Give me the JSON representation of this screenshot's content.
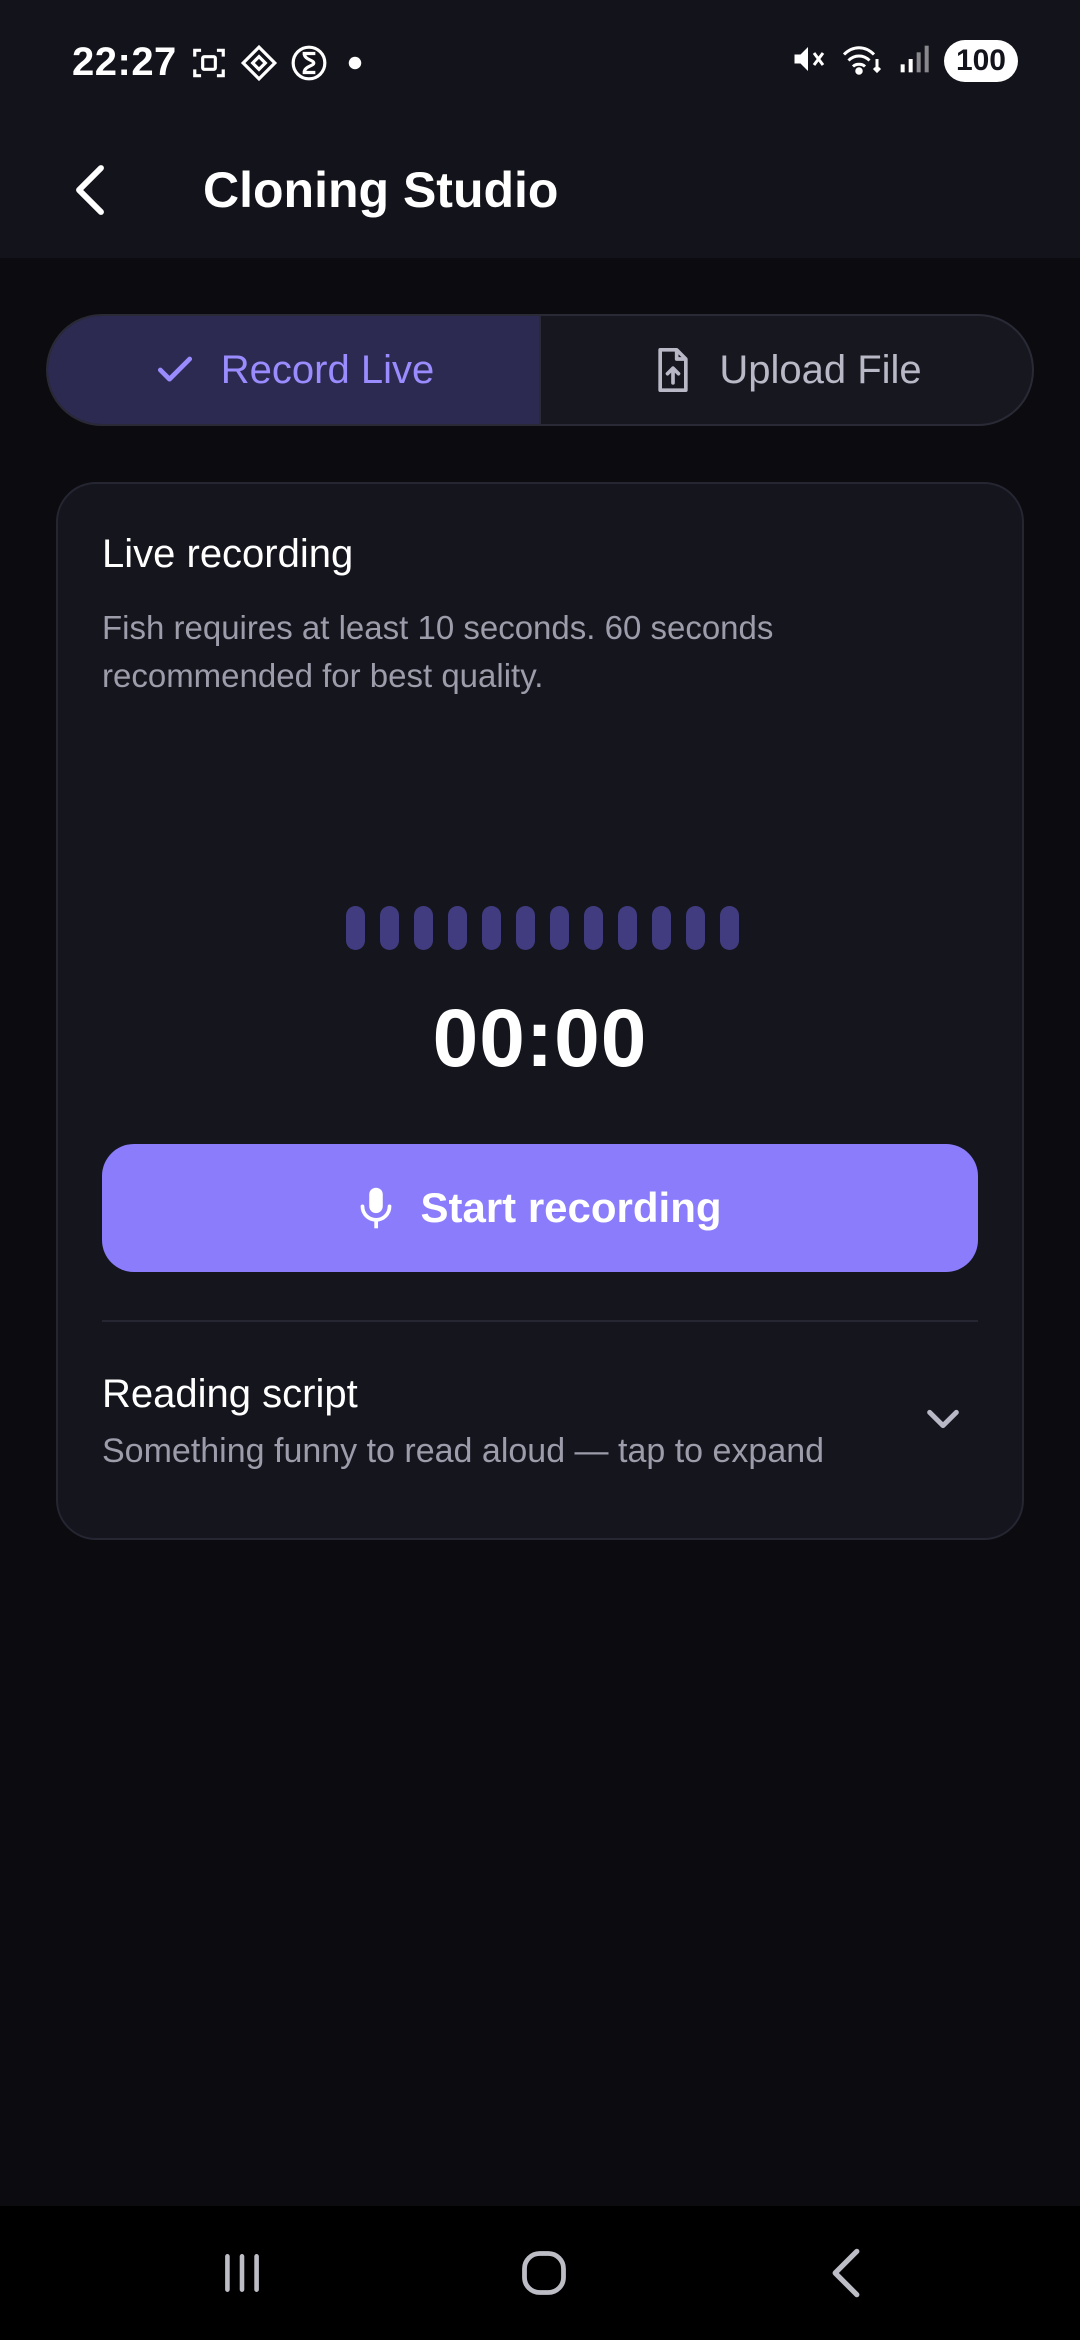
{
  "status_bar": {
    "time": "22:27",
    "battery": "100"
  },
  "header": {
    "title": "Cloning Studio"
  },
  "tabs": [
    {
      "label": "Record Live",
      "active": true,
      "icon": "check-icon"
    },
    {
      "label": "Upload File",
      "active": false,
      "icon": "file-upload-icon"
    }
  ],
  "card": {
    "title": "Live recording",
    "description": "Fish requires at least 10 seconds. 60 seconds recommended for best quality.",
    "timer": "00:00",
    "start_button_label": "Start recording",
    "script_title": "Reading script",
    "script_subtitle": "Something funny to read aloud — tap to expand"
  },
  "colors": {
    "accent": "#8a7cfb",
    "accent_text": "#9a8cff",
    "background": "#0b0b10",
    "card": "#15151e",
    "level_bar": "#413b80"
  }
}
